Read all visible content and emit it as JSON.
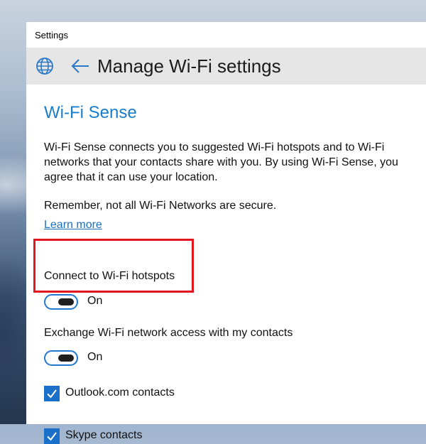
{
  "window": {
    "title": "Settings"
  },
  "header": {
    "title": "Manage Wi-Fi settings",
    "globe_icon": "globe-icon",
    "back_icon": "back-arrow-icon"
  },
  "main": {
    "section_title": "Wi-Fi Sense",
    "description": "Wi-Fi Sense connects you to suggested Wi-Fi hotspots and to Wi-Fi networks that your contacts share with you. By using Wi-Fi Sense, you agree that it can use your location.",
    "remember_text": "Remember, not all Wi-Fi Networks are secure.",
    "learn_more_link": "Learn more",
    "connect_hotspots": {
      "label": "Connect to Wi-Fi hotspots",
      "state": "On"
    },
    "exchange_access": {
      "label": "Exchange Wi-Fi network access with my contacts",
      "state": "On"
    },
    "contacts": [
      {
        "label": "Outlook.com contacts",
        "checked": true
      },
      {
        "label": "Skype contacts",
        "checked": true
      }
    ]
  },
  "colors": {
    "accent": "#1a7dcc",
    "highlight": "#e2161c",
    "header_bg": "#e6e6e6"
  }
}
